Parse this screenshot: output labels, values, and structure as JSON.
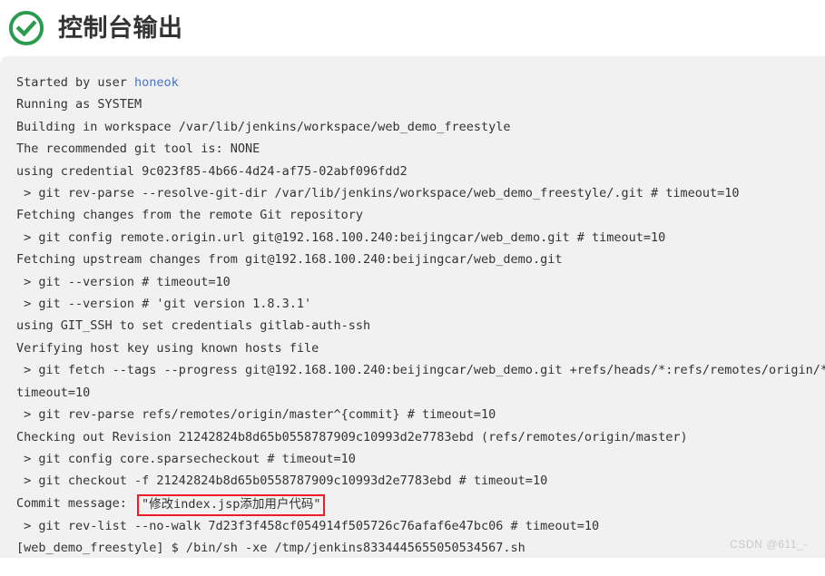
{
  "header": {
    "title": "控制台输出",
    "icon": "check-circle-icon",
    "icon_color": "#2a9a4f"
  },
  "console": {
    "background": "#f1f1f1",
    "text_color": "#333333",
    "link_color": "#4a72c4",
    "highlight_border_color": "#ee1c25",
    "lines": [
      {
        "text": "Started by user ",
        "link": "honeok"
      },
      {
        "text": "Running as SYSTEM"
      },
      {
        "text": "Building in workspace /var/lib/jenkins/workspace/web_demo_freestyle"
      },
      {
        "text": "The recommended git tool is: NONE"
      },
      {
        "text": "using credential 9c023f85-4b66-4d24-af75-02abf096fdd2"
      },
      {
        "text": " > git rev-parse --resolve-git-dir /var/lib/jenkins/workspace/web_demo_freestyle/.git # timeout=10"
      },
      {
        "text": "Fetching changes from the remote Git repository"
      },
      {
        "text": " > git config remote.origin.url git@192.168.100.240:beijingcar/web_demo.git # timeout=10"
      },
      {
        "text": "Fetching upstream changes from git@192.168.100.240:beijingcar/web_demo.git"
      },
      {
        "text": " > git --version # timeout=10"
      },
      {
        "text": " > git --version # 'git version 1.8.3.1'"
      },
      {
        "text": "using GIT_SSH to set credentials gitlab-auth-ssh"
      },
      {
        "text": "Verifying host key using known hosts file"
      },
      {
        "text": " > git fetch --tags --progress git@192.168.100.240:beijingcar/web_demo.git +refs/heads/*:refs/remotes/origin/* #"
      },
      {
        "text": "timeout=10"
      },
      {
        "text": " > git rev-parse refs/remotes/origin/master^{commit} # timeout=10"
      },
      {
        "text": "Checking out Revision 21242824b8d65b0558787909c10993d2e7783ebd (refs/remotes/origin/master)"
      },
      {
        "text": " > git config core.sparsecheckout # timeout=10"
      },
      {
        "text": " > git checkout -f 21242824b8d65b0558787909c10993d2e7783ebd # timeout=10"
      },
      {
        "text": "Commit message: ",
        "highlight": "\"修改index.jsp添加用户代码\""
      },
      {
        "text": " > git rev-list --no-walk 7d23f3f458cf054914f505726c76afaf6e47bc06 # timeout=10"
      },
      {
        "text": "[web_demo_freestyle] $ /bin/sh -xe /tmp/jenkins8334445655050534567.sh"
      }
    ]
  },
  "watermark": {
    "text": "CSDN @611_-"
  }
}
